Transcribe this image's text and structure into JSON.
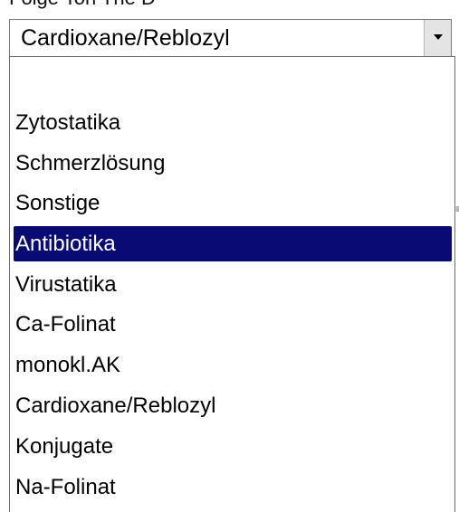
{
  "header": {
    "label_fragment": "Folge Ton The D"
  },
  "combo": {
    "selected_value": "Cardioxane/Reblozyl",
    "button_icon": "chevron-down-icon"
  },
  "dropdown": {
    "items": [
      {
        "label": ""
      },
      {
        "label": "Zytostatika"
      },
      {
        "label": "Schmerzlösung"
      },
      {
        "label": "Sonstige"
      },
      {
        "label": "Antibiotika",
        "highlighted": true
      },
      {
        "label": "Virustatika"
      },
      {
        "label": "Ca-Folinat"
      },
      {
        "label": "monokl.AK"
      },
      {
        "label": "Cardioxane/Reblozyl"
      },
      {
        "label": "Konjugate"
      },
      {
        "label": "Na-Folinat"
      }
    ],
    "highlight_color": "#0a0a74"
  }
}
